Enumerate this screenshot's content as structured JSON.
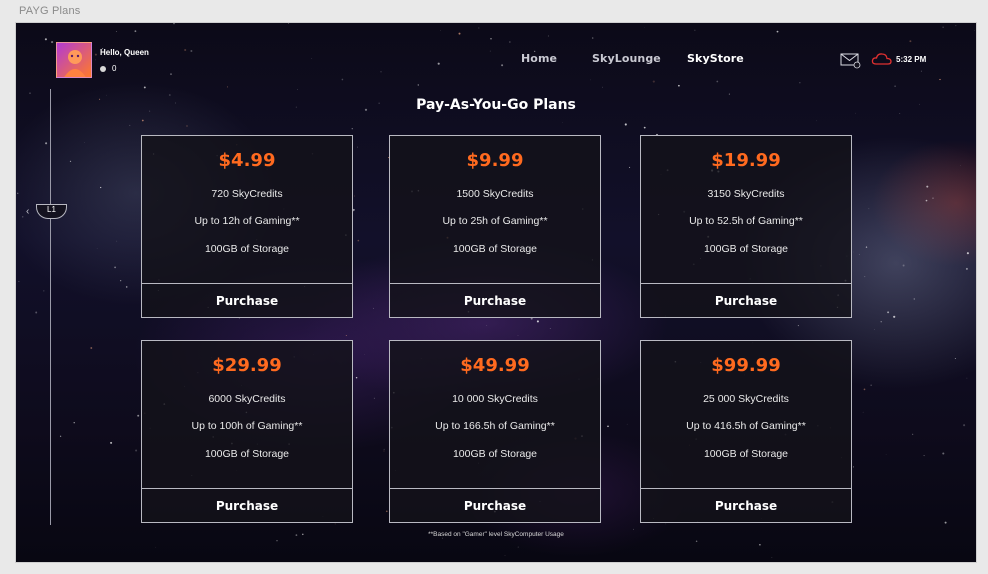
{
  "frame_label": "PAYG Plans",
  "user": {
    "greeting": "Hello, Queen",
    "coins": "0"
  },
  "nav": {
    "home": "Home",
    "skylounge": "SkyLounge",
    "skystore": "SkyStore"
  },
  "status": {
    "time": "5:32 PM"
  },
  "level": "L1",
  "page_title": "Pay-As-You-Go Plans",
  "plans": [
    {
      "price": "$4.99",
      "credits": "720 SkyCredits",
      "gaming": "Up to 12h of Gaming**",
      "storage": "100GB of Storage",
      "button": "Purchase"
    },
    {
      "price": "$9.99",
      "credits": "1500 SkyCredits",
      "gaming": "Up to 25h of Gaming**",
      "storage": "100GB of Storage",
      "button": "Purchase"
    },
    {
      "price": "$19.99",
      "credits": "3150 SkyCredits",
      "gaming": "Up to 52.5h of Gaming**",
      "storage": "100GB of Storage",
      "button": "Purchase"
    },
    {
      "price": "$29.99",
      "credits": "6000 SkyCredits",
      "gaming": "Up to 100h of Gaming**",
      "storage": "100GB of Storage",
      "button": "Purchase"
    },
    {
      "price": "$49.99",
      "credits": "10 000 SkyCredits",
      "gaming": "Up to 166.5h of Gaming**",
      "storage": "100GB of Storage",
      "button": "Purchase"
    },
    {
      "price": "$99.99",
      "credits": "25 000 SkyCredits",
      "gaming": "Up to 416.5h of Gaming**",
      "storage": "100GB of Storage",
      "button": "Purchase"
    }
  ],
  "footnote": "**Based on \"Gamer\" level SkyComputer Usage",
  "colors": {
    "accent": "#ff6a1f",
    "background": "#0e0b1c",
    "card_border": "#b9b9c2"
  }
}
